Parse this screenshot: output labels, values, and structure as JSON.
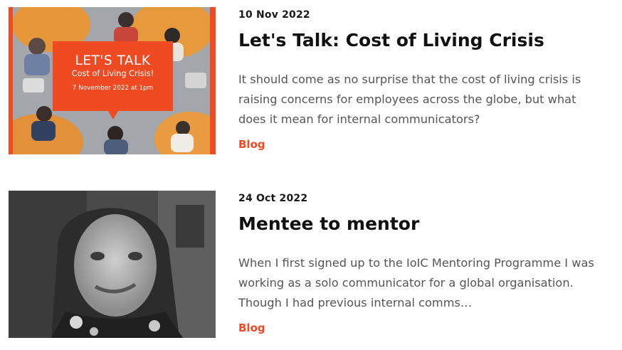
{
  "posts": [
    {
      "date": "10 Nov 2022",
      "title": "Let's Talk: Cost of Living Crisis",
      "excerpt": "It should come as no surprise that the cost of living crisis is raising concerns for employees across the globe, but what does it mean for internal communicators?",
      "tag": "Blog",
      "thumb": {
        "heading": "LET'S TALK",
        "subheading": "Cost of Living Crisis!",
        "date_line": "7 November 2022 at 1pm",
        "accent": "#f04a22"
      }
    },
    {
      "date": "24 Oct 2022",
      "title": "Mentee to mentor",
      "excerpt": "When I first signed up to the IoIC Mentoring Programme I was working as a solo communicator for a global organisation. Though I had previous internal comms…",
      "tag": "Blog"
    }
  ],
  "colors": {
    "accent": "#f04a22",
    "title": "#111111",
    "body": "#555555"
  }
}
